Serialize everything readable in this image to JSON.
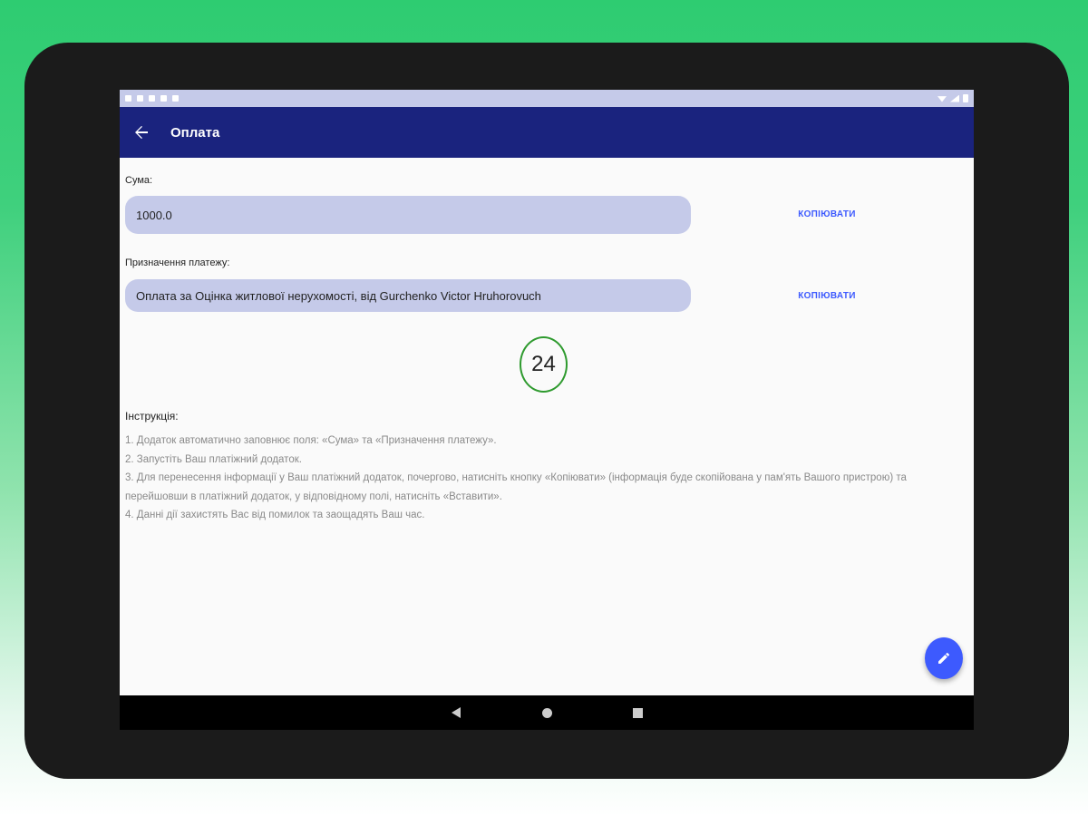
{
  "app_bar": {
    "title": "Оплата"
  },
  "icons": {
    "back": "arrow-left-icon",
    "fab": "pencil-icon"
  },
  "form": {
    "amount": {
      "label": "Сума:",
      "value": "1000.0",
      "copy_label": "КОПІЮВАТИ"
    },
    "purpose": {
      "label": "Призначення платежу:",
      "value": "Оплата за Оцінка житлової нерухомості, від Gurchenko Victor Hruhorovuch",
      "copy_label": "КОПІЮВАТИ"
    }
  },
  "timer": {
    "value": "24"
  },
  "instructions": {
    "title": "Інструкція:",
    "items": [
      "1. Додаток автоматично заповнює поля: «Сума» та «Призначення платежу».",
      " 2. Запустіть Ваш платіжний додаток.",
      " 3. Для перенесення інформації у Ваш платіжний додаток, почергово, натисніть кнопку «Копіювати» (інформація буде скопійована у пам'ять Вашого пристрою) та перейшовши в платіжний додаток, у відповідному полі, натисніть «Вставити».",
      " 4. Данні дії захистять Вас від помилок та заощадять Ваш час."
    ]
  },
  "colors": {
    "app_bar": "#1a237e",
    "field_bg": "#c5cae9",
    "accent": "#3d5afe",
    "timer_ring": "#2e9a2e"
  }
}
